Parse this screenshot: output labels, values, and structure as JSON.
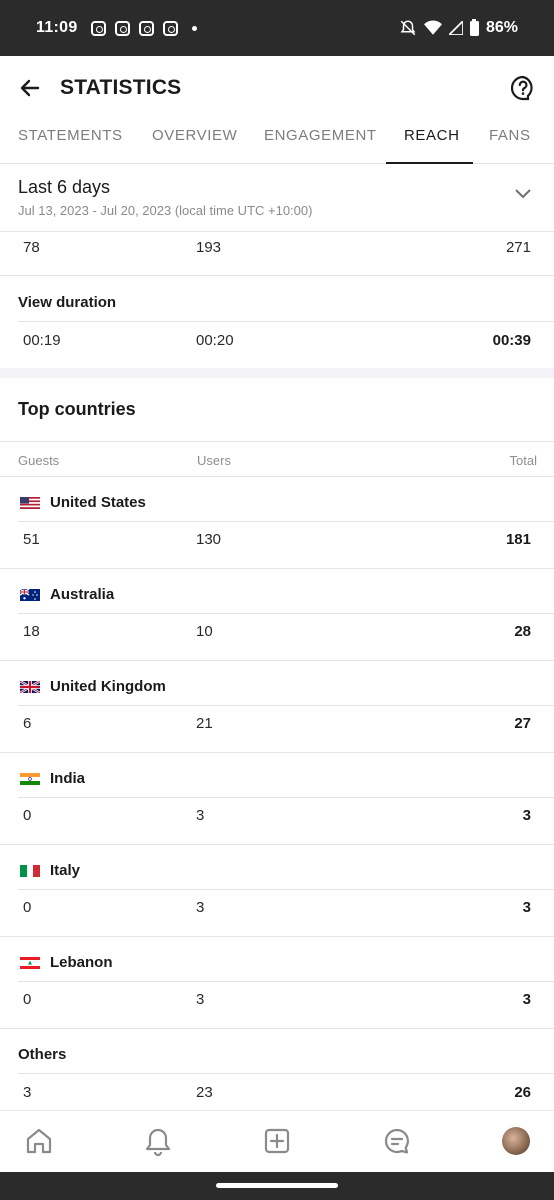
{
  "status_bar": {
    "time": "11:09",
    "battery": "86%",
    "notification_icons": [
      "instagram-icon",
      "instagram-icon",
      "instagram-icon",
      "instagram-icon"
    ]
  },
  "header": {
    "title": "STATISTICS"
  },
  "tabs": [
    {
      "label": "STATEMENTS",
      "active": false
    },
    {
      "label": "OVERVIEW",
      "active": false
    },
    {
      "label": "ENGAGEMENT",
      "active": false
    },
    {
      "label": "REACH",
      "active": true
    },
    {
      "label": "FANS",
      "active": false
    }
  ],
  "date_range": {
    "title": "Last 6 days",
    "subtitle": "Jul 13, 2023 - Jul 20, 2023 (local time UTC +10:00)"
  },
  "views_row": {
    "guests": "78",
    "users": "193",
    "total": "271"
  },
  "view_duration": {
    "label": "View duration",
    "guests": "00:19",
    "users": "00:20",
    "total": "00:39"
  },
  "top_countries": {
    "title": "Top countries",
    "columns": {
      "guests": "Guests",
      "users": "Users",
      "total": "Total"
    },
    "rows": [
      {
        "name": "United States",
        "flag": "us-flag-icon",
        "guests": "51",
        "users": "130",
        "total": "181"
      },
      {
        "name": "Australia",
        "flag": "australia-flag-icon",
        "guests": "18",
        "users": "10",
        "total": "28"
      },
      {
        "name": "United Kingdom",
        "flag": "uk-flag-icon",
        "guests": "6",
        "users": "21",
        "total": "27"
      },
      {
        "name": "India",
        "flag": "india-flag-icon",
        "guests": "0",
        "users": "3",
        "total": "3"
      },
      {
        "name": "Italy",
        "flag": "italy-flag-icon",
        "guests": "0",
        "users": "3",
        "total": "3"
      },
      {
        "name": "Lebanon",
        "flag": "lebanon-flag-icon",
        "guests": "0",
        "users": "3",
        "total": "3"
      }
    ],
    "others": {
      "name": "Others",
      "guests": "3",
      "users": "23",
      "total": "26"
    }
  },
  "bottom_nav": [
    "home-icon",
    "bell-icon",
    "add-post-icon",
    "messages-icon",
    "profile-avatar"
  ],
  "colors": {
    "text": "#1b1b1b",
    "muted": "#8a8a8a",
    "divider": "#e3e3e3",
    "status_bar": "#2b2b2b"
  }
}
